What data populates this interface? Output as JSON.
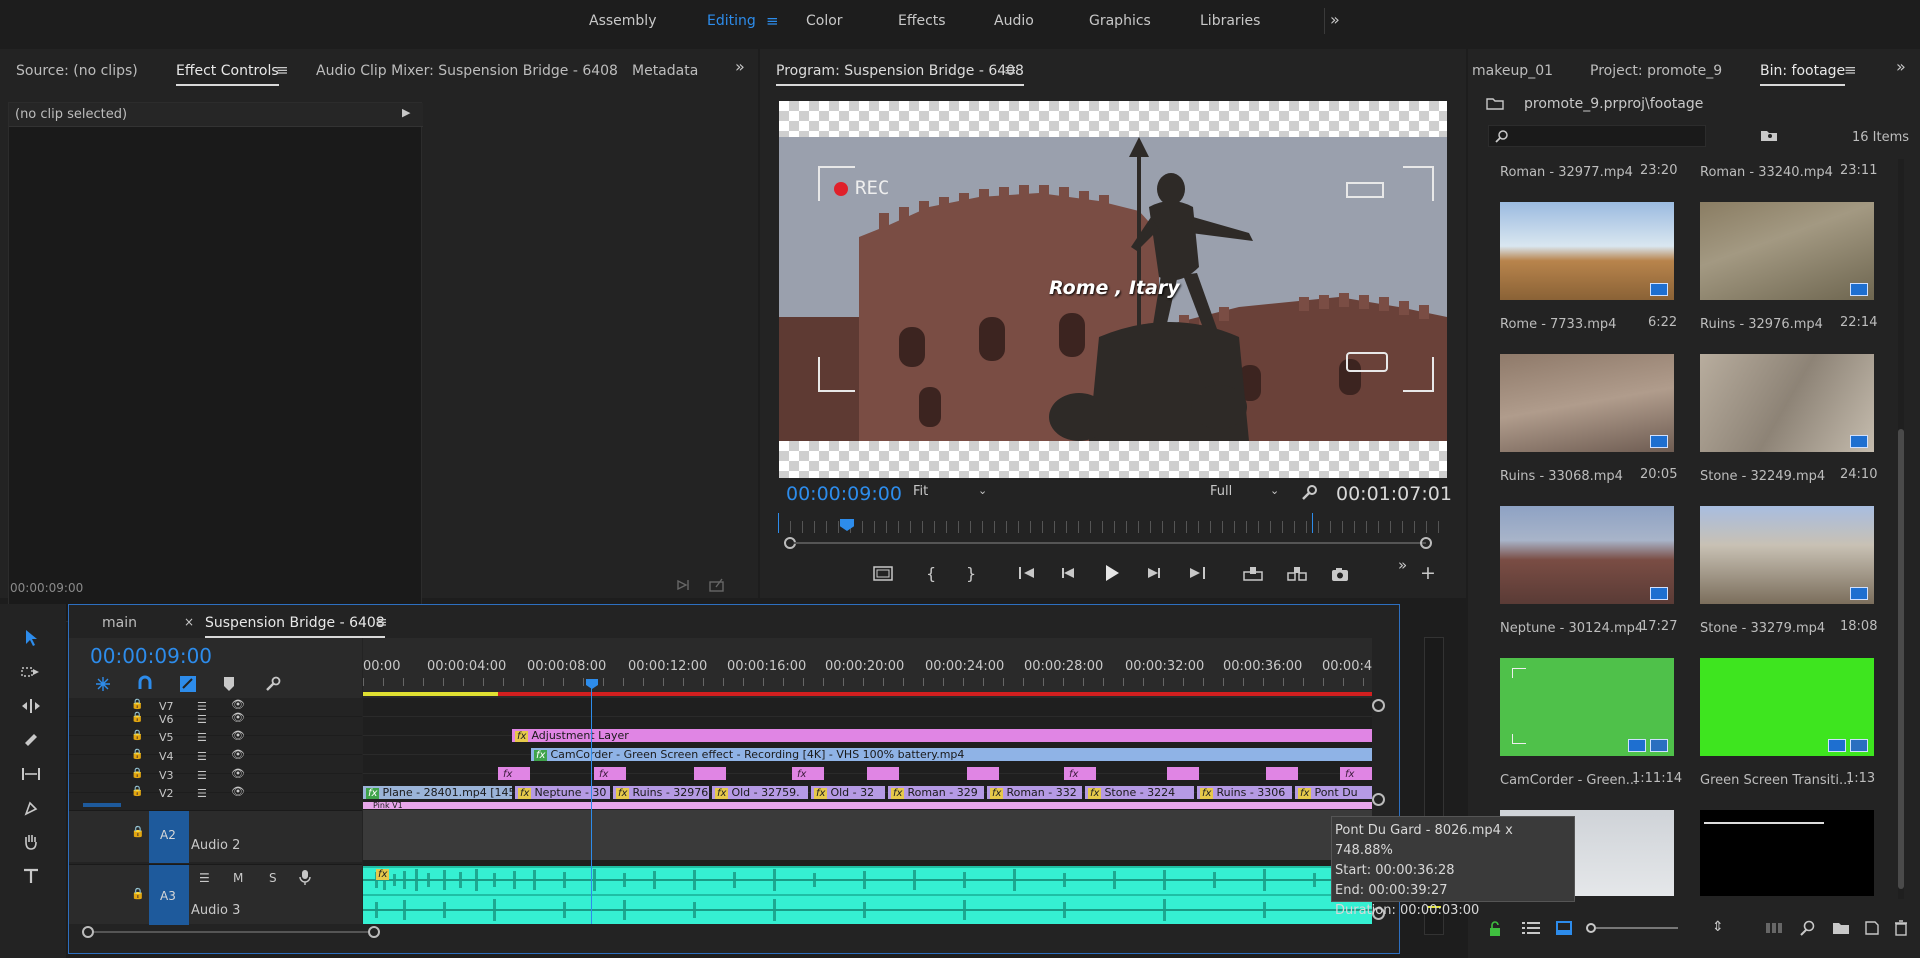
{
  "workspace_tabs": [
    "Assembly",
    "Editing",
    "Color",
    "Effects",
    "Audio",
    "Graphics",
    "Libraries"
  ],
  "source_panel": {
    "tabs": [
      "Source: (no clips)",
      "Effect Controls",
      "Audio Clip Mixer: Suspension Bridge - 6408",
      "Metadata"
    ],
    "clip_status": "(no clip selected)",
    "timecode": "00:00:09:00"
  },
  "program_monitor": {
    "title": "Program: Suspension Bridge - 6408",
    "overlay_rec": "REC",
    "overlay_title": "Rome , Itary",
    "current_time": "00:00:09:00",
    "fit": "Fit",
    "resolution": "Full",
    "duration": "00:01:07:01"
  },
  "project_panel": {
    "tabs": [
      "makeup_01",
      "Project: promote_9",
      "Bin: footage"
    ],
    "path": "promote_9.prproj\\footage",
    "item_count": "16 Items",
    "items": [
      {
        "name": "Roman - 32977.mp4",
        "duration": "23:20"
      },
      {
        "name": "Roman - 33240.mp4",
        "duration": "23:11"
      },
      {
        "name": "Rome - 7733.mp4",
        "duration": "6:22"
      },
      {
        "name": "Ruins - 32976.mp4",
        "duration": "22:14"
      },
      {
        "name": "Ruins - 33068.mp4",
        "duration": "20:05"
      },
      {
        "name": "Stone - 32249.mp4",
        "duration": "24:10"
      },
      {
        "name": "Neptune - 30124.mp4",
        "duration": "17:27"
      },
      {
        "name": "Stone - 33279.mp4",
        "duration": "18:08"
      },
      {
        "name": "CamCorder - Green...",
        "duration": "1:11:14"
      },
      {
        "name": "Green Screen Transiti...",
        "duration": "1:13"
      }
    ]
  },
  "timeline": {
    "tabs": [
      "main",
      "Suspension Bridge - 6408"
    ],
    "current_time": "00:00:09:00",
    "ruler": [
      "00:00",
      "00:00:04:00",
      "00:00:08:00",
      "00:00:12:00",
      "00:00:16:00",
      "00:00:20:00",
      "00:00:24:00",
      "00:00:28:00",
      "00:00:32:00",
      "00:00:36:00",
      "00:00:4"
    ],
    "video_tracks": [
      "V7",
      "V6",
      "V5",
      "V4",
      "V3",
      "V2"
    ],
    "audio_tracks": [
      {
        "id": "A2",
        "name": "Audio 2"
      },
      {
        "id": "A3",
        "name": "Audio 3"
      }
    ],
    "track_controls": {
      "mute": "M",
      "solo": "S"
    },
    "clips": {
      "adjustment": "Adjustment Layer",
      "camcorder": "CamCorder - Green Screen effect - Recording  [4K] - VHS  100% battery.mp4",
      "v2": [
        "Plane - 28401.mp4 [145",
        "Neptune - 30",
        "Ruins - 32976",
        "Old - 32759.",
        "Old - 32",
        "Roman - 329",
        "Roman - 332",
        "Stone - 3224",
        "Ruins - 3306",
        "Pont Du"
      ],
      "v1_partial": "Pink V1"
    },
    "fx_label": "fx",
    "tooltip": {
      "title": "Pont Du Gard - 8026.mp4 x 748.88%",
      "start": "Start: 00:00:36:28",
      "end": "End: 00:00:39:27",
      "duration": "Duration: 00:00:03:00"
    }
  }
}
